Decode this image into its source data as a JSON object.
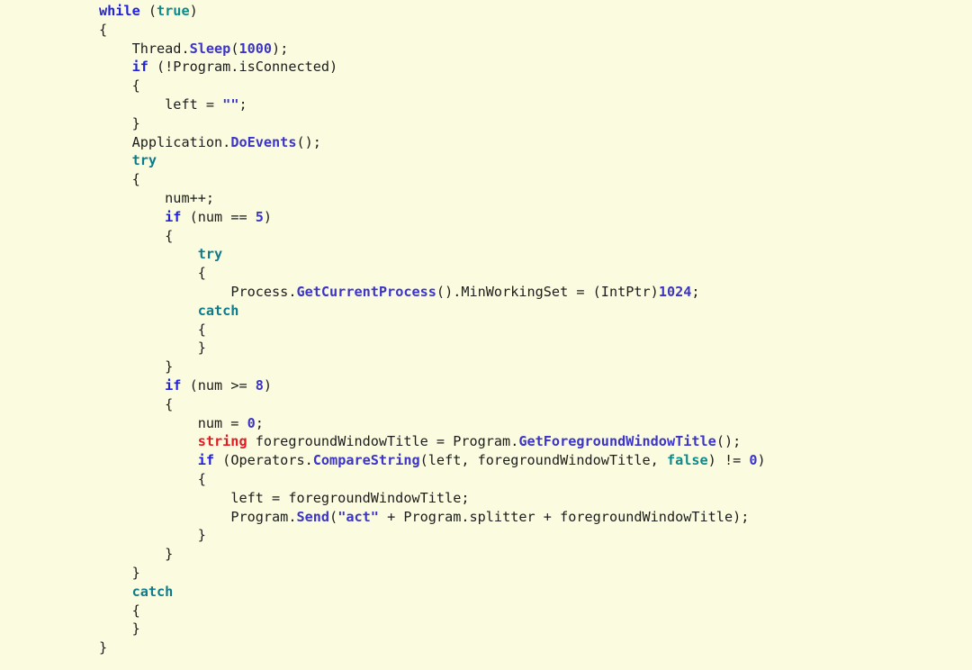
{
  "editor": {
    "name": "code-viewer",
    "language": "C#",
    "background_color": "#fbfbe0",
    "default_text_color": "#1c1c1c",
    "colors": {
      "keyword_control": "#2222dd",
      "keyword_exception": "#0d7b8a",
      "type": "#e01b24",
      "method": "#3b34c7",
      "number": "#3b34c7",
      "string": "#3b34c7",
      "literal": "#0d8a8a",
      "plain": "#1c1c1c"
    },
    "indent_unit": "    "
  },
  "code": {
    "lines": [
      {
        "id": "l1",
        "indent": 0,
        "tokens": [
          {
            "t": "while",
            "c": "kw"
          },
          {
            "t": " (",
            "c": "plain"
          },
          {
            "t": "true",
            "c": "lit"
          },
          {
            "t": ")",
            "c": "plain"
          }
        ]
      },
      {
        "id": "l2",
        "indent": 0,
        "tokens": [
          {
            "t": "{",
            "c": "plain"
          }
        ]
      },
      {
        "id": "l3",
        "indent": 1,
        "tokens": [
          {
            "t": "Thread.",
            "c": "plain"
          },
          {
            "t": "Sleep",
            "c": "method"
          },
          {
            "t": "(",
            "c": "plain"
          },
          {
            "t": "1000",
            "c": "num"
          },
          {
            "t": ");",
            "c": "plain"
          }
        ]
      },
      {
        "id": "l4",
        "indent": 1,
        "tokens": [
          {
            "t": "if",
            "c": "kw"
          },
          {
            "t": " (!Program.isConnected)",
            "c": "plain"
          }
        ]
      },
      {
        "id": "l5",
        "indent": 1,
        "tokens": [
          {
            "t": "{",
            "c": "plain"
          }
        ]
      },
      {
        "id": "l6",
        "indent": 2,
        "tokens": [
          {
            "t": "left = ",
            "c": "plain"
          },
          {
            "t": "\"\"",
            "c": "str"
          },
          {
            "t": ";",
            "c": "plain"
          }
        ]
      },
      {
        "id": "l7",
        "indent": 1,
        "tokens": [
          {
            "t": "}",
            "c": "plain"
          }
        ]
      },
      {
        "id": "l8",
        "indent": 1,
        "tokens": [
          {
            "t": "Application.",
            "c": "plain"
          },
          {
            "t": "DoEvents",
            "c": "method"
          },
          {
            "t": "();",
            "c": "plain"
          }
        ]
      },
      {
        "id": "l9",
        "indent": 1,
        "tokens": [
          {
            "t": "try",
            "c": "kw2"
          }
        ]
      },
      {
        "id": "l10",
        "indent": 1,
        "tokens": [
          {
            "t": "{",
            "c": "plain"
          }
        ]
      },
      {
        "id": "l11",
        "indent": 2,
        "tokens": [
          {
            "t": "num++;",
            "c": "plain"
          }
        ]
      },
      {
        "id": "l12",
        "indent": 2,
        "tokens": [
          {
            "t": "if",
            "c": "kw"
          },
          {
            "t": " (num == ",
            "c": "plain"
          },
          {
            "t": "5",
            "c": "num"
          },
          {
            "t": ")",
            "c": "plain"
          }
        ]
      },
      {
        "id": "l13",
        "indent": 2,
        "tokens": [
          {
            "t": "{",
            "c": "plain"
          }
        ]
      },
      {
        "id": "l14",
        "indent": 3,
        "tokens": [
          {
            "t": "try",
            "c": "kw2"
          }
        ]
      },
      {
        "id": "l15",
        "indent": 3,
        "tokens": [
          {
            "t": "{",
            "c": "plain"
          }
        ]
      },
      {
        "id": "l16",
        "indent": 4,
        "tokens": [
          {
            "t": "Process.",
            "c": "plain"
          },
          {
            "t": "GetCurrentProcess",
            "c": "method"
          },
          {
            "t": "().MinWorkingSet = (IntPtr)",
            "c": "plain"
          },
          {
            "t": "1024",
            "c": "num"
          },
          {
            "t": ";",
            "c": "plain"
          }
        ]
      },
      {
        "id": "l17",
        "indent": 3,
        "tokens": [
          {
            "t": "catch",
            "c": "kw2"
          }
        ]
      },
      {
        "id": "l18",
        "indent": 3,
        "tokens": [
          {
            "t": "{",
            "c": "plain"
          }
        ]
      },
      {
        "id": "l19",
        "indent": 3,
        "tokens": [
          {
            "t": "}",
            "c": "plain"
          }
        ]
      },
      {
        "id": "l20",
        "indent": 2,
        "tokens": [
          {
            "t": "}",
            "c": "plain"
          }
        ]
      },
      {
        "id": "l21",
        "indent": 2,
        "tokens": [
          {
            "t": "if",
            "c": "kw"
          },
          {
            "t": " (num >= ",
            "c": "plain"
          },
          {
            "t": "8",
            "c": "num"
          },
          {
            "t": ")",
            "c": "plain"
          }
        ]
      },
      {
        "id": "l22",
        "indent": 2,
        "tokens": [
          {
            "t": "{",
            "c": "plain"
          }
        ]
      },
      {
        "id": "l23",
        "indent": 3,
        "tokens": [
          {
            "t": "num = ",
            "c": "plain"
          },
          {
            "t": "0",
            "c": "num"
          },
          {
            "t": ";",
            "c": "plain"
          }
        ]
      },
      {
        "id": "l24",
        "indent": 3,
        "tokens": [
          {
            "t": "string",
            "c": "type"
          },
          {
            "t": " foregroundWindowTitle = Program.",
            "c": "plain"
          },
          {
            "t": "GetForegroundWindowTitle",
            "c": "method"
          },
          {
            "t": "();",
            "c": "plain"
          }
        ]
      },
      {
        "id": "l25",
        "indent": 3,
        "tokens": [
          {
            "t": "if",
            "c": "kw"
          },
          {
            "t": " (Operators.",
            "c": "plain"
          },
          {
            "t": "CompareString",
            "c": "method"
          },
          {
            "t": "(left, foregroundWindowTitle, ",
            "c": "plain"
          },
          {
            "t": "false",
            "c": "lit"
          },
          {
            "t": ") != ",
            "c": "plain"
          },
          {
            "t": "0",
            "c": "num"
          },
          {
            "t": ")",
            "c": "plain"
          }
        ]
      },
      {
        "id": "l26",
        "indent": 3,
        "tokens": [
          {
            "t": "{",
            "c": "plain"
          }
        ]
      },
      {
        "id": "l27",
        "indent": 4,
        "tokens": [
          {
            "t": "left = foregroundWindowTitle;",
            "c": "plain"
          }
        ]
      },
      {
        "id": "l28",
        "indent": 4,
        "tokens": [
          {
            "t": "Program.",
            "c": "plain"
          },
          {
            "t": "Send",
            "c": "method"
          },
          {
            "t": "(",
            "c": "plain"
          },
          {
            "t": "\"act\"",
            "c": "str"
          },
          {
            "t": " + Program.splitter + foregroundWindowTitle);",
            "c": "plain"
          }
        ]
      },
      {
        "id": "l29",
        "indent": 3,
        "tokens": [
          {
            "t": "}",
            "c": "plain"
          }
        ]
      },
      {
        "id": "l30",
        "indent": 2,
        "tokens": [
          {
            "t": "}",
            "c": "plain"
          }
        ]
      },
      {
        "id": "l31",
        "indent": 1,
        "tokens": [
          {
            "t": "}",
            "c": "plain"
          }
        ]
      },
      {
        "id": "l32",
        "indent": 1,
        "tokens": [
          {
            "t": "catch",
            "c": "kw2"
          }
        ]
      },
      {
        "id": "l33",
        "indent": 1,
        "tokens": [
          {
            "t": "{",
            "c": "plain"
          }
        ]
      },
      {
        "id": "l34",
        "indent": 1,
        "tokens": [
          {
            "t": "}",
            "c": "plain"
          }
        ]
      },
      {
        "id": "l35",
        "indent": 0,
        "tokens": [
          {
            "t": "}",
            "c": "plain"
          }
        ]
      }
    ]
  }
}
